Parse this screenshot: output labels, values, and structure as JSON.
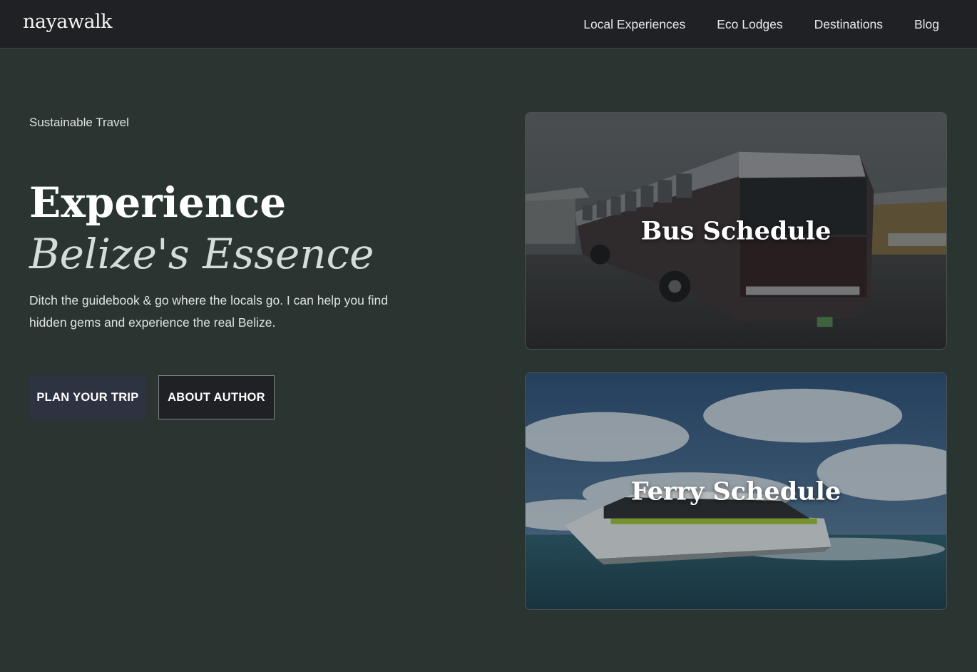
{
  "brand": {
    "logo": "nayawalk"
  },
  "nav": {
    "items": [
      {
        "label": "Local Experiences"
      },
      {
        "label": "Eco Lodges"
      },
      {
        "label": "Destinations"
      },
      {
        "label": "Blog"
      }
    ]
  },
  "hero": {
    "eyebrow": "Sustainable Travel",
    "title_line1": "Experience",
    "title_line2": "Belize's Essence",
    "description": "Ditch the guidebook & go where the locals go. I can help you find hidden gems and experience the real Belize.",
    "primary_button": "PLAN YOUR TRIP",
    "secondary_button": "ABOUT AUTHOR"
  },
  "cards": [
    {
      "title": "Bus Schedule",
      "image": "bus-photo"
    },
    {
      "title": "Ferry Schedule",
      "image": "ferry-photo"
    }
  ],
  "colors": {
    "page_bg": "#2a3532",
    "nav_bg": "#1f2125",
    "primary_button_bg": "#2d3340",
    "secondary_button_bg": "#1f2125"
  }
}
